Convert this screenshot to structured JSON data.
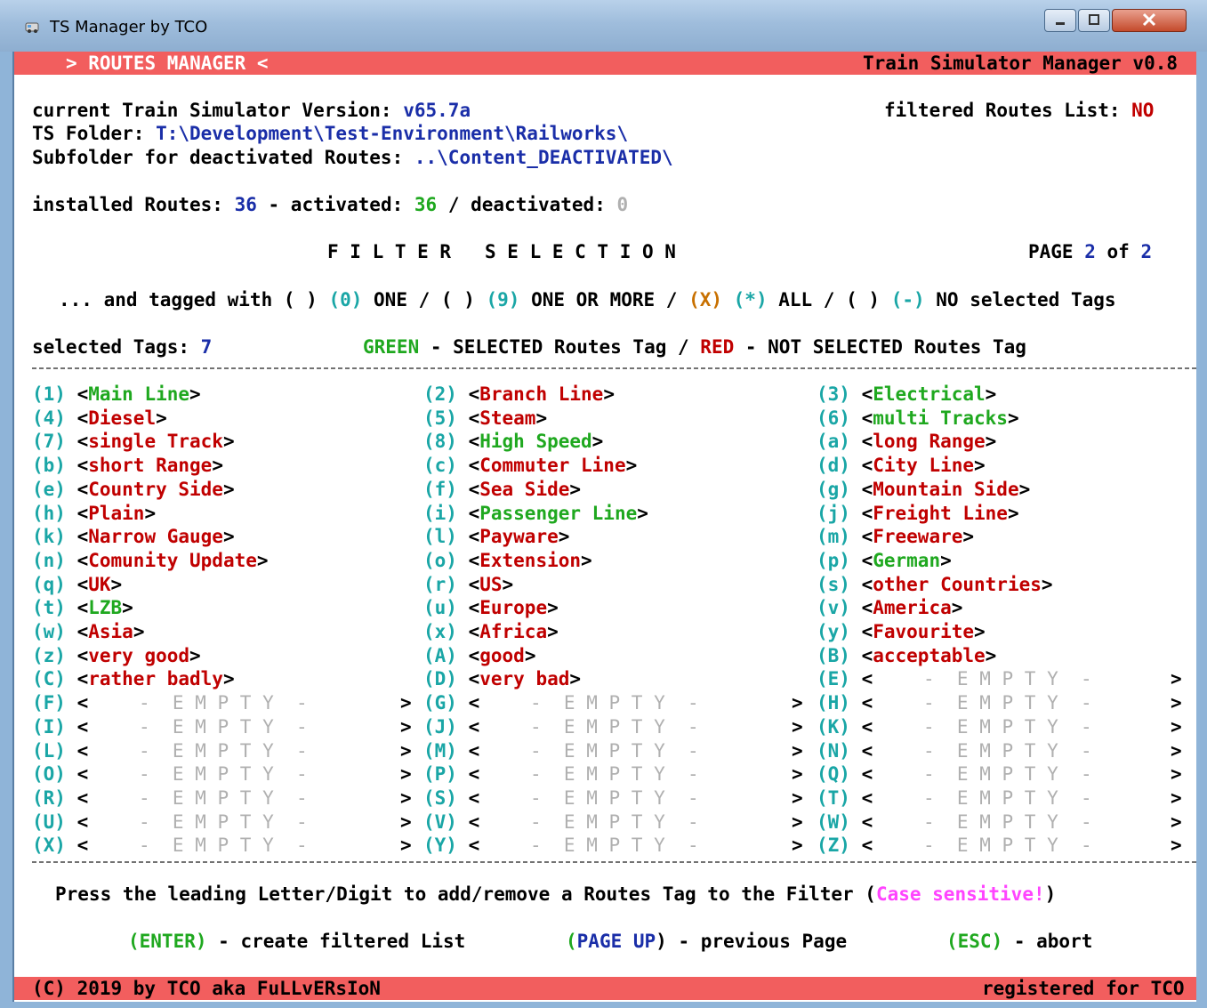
{
  "window": {
    "title": "TS Manager by TCO"
  },
  "header": {
    "left": "> ROUTES MANAGER <",
    "right": "Train Simulator Manager v0.8"
  },
  "info": {
    "version_label": "current Train Simulator Version: ",
    "version_value": "v65.7a",
    "filtered_label": "filtered Routes List: ",
    "filtered_value": "NO",
    "folder_label": "TS Folder: ",
    "folder_value": "T:\\Development\\Test-Environment\\Railworks\\",
    "subfolder_label": "Subfolder for deactivated Routes: ",
    "subfolder_value": "..\\Content_DEACTIVATED\\",
    "installed_label": "installed Routes: ",
    "installed_value": "36",
    "activated_label": " - activated: ",
    "activated_value": "36",
    "deactivated_label": " / deactivated: ",
    "deactivated_value": "0"
  },
  "filter": {
    "heading": "F I L T E R   S E L E C T I O N",
    "page_label": "PAGE ",
    "page_current": "2",
    "page_of": " of ",
    "page_total": "2",
    "tagged_prefix": "... and tagged with ",
    "opt1_box": "( ) ",
    "opt1_key": "(0)",
    "opt1_text": " ONE / ",
    "opt2_box": "( ) ",
    "opt2_key": "(9)",
    "opt2_text": " ONE OR MORE / ",
    "opt3_box": "(X) ",
    "opt3_key": "(*)",
    "opt3_text": " ALL / ",
    "opt4_box": "( ) ",
    "opt4_key": "(-)",
    "opt4_text": " NO selected Tags",
    "selected_label": "selected Tags: ",
    "selected_value": "7",
    "legend_green": "GREEN",
    "legend_mid": " - SELECTED Routes Tag / ",
    "legend_red": "RED",
    "legend_end": " - NOT SELECTED Routes Tag"
  },
  "tags": [
    {
      "key": "(1)",
      "name": "Main Line",
      "color": "#1fa81f"
    },
    {
      "key": "(2)",
      "name": "Branch Line",
      "color": "#c00000"
    },
    {
      "key": "(3)",
      "name": "Electrical",
      "color": "#1fa81f"
    },
    {
      "key": "(4)",
      "name": "Diesel",
      "color": "#c00000"
    },
    {
      "key": "(5)",
      "name": "Steam",
      "color": "#c00000"
    },
    {
      "key": "(6)",
      "name": "multi Tracks",
      "color": "#1fa81f"
    },
    {
      "key": "(7)",
      "name": "single Track",
      "color": "#c00000"
    },
    {
      "key": "(8)",
      "name": "High Speed",
      "color": "#1fa81f"
    },
    {
      "key": "(a)",
      "name": "long Range",
      "color": "#c00000"
    },
    {
      "key": "(b)",
      "name": "short Range",
      "color": "#c00000"
    },
    {
      "key": "(c)",
      "name": "Commuter Line",
      "color": "#c00000"
    },
    {
      "key": "(d)",
      "name": "City Line",
      "color": "#c00000"
    },
    {
      "key": "(e)",
      "name": "Country Side",
      "color": "#c00000"
    },
    {
      "key": "(f)",
      "name": "Sea Side",
      "color": "#c00000"
    },
    {
      "key": "(g)",
      "name": "Mountain Side",
      "color": "#c00000"
    },
    {
      "key": "(h)",
      "name": "Plain",
      "color": "#c00000"
    },
    {
      "key": "(i)",
      "name": "Passenger Line",
      "color": "#1fa81f"
    },
    {
      "key": "(j)",
      "name": "Freight Line",
      "color": "#c00000"
    },
    {
      "key": "(k)",
      "name": "Narrow Gauge",
      "color": "#c00000"
    },
    {
      "key": "(l)",
      "name": "Payware",
      "color": "#c00000"
    },
    {
      "key": "(m)",
      "name": "Freeware",
      "color": "#c00000"
    },
    {
      "key": "(n)",
      "name": "Comunity Update",
      "color": "#c00000"
    },
    {
      "key": "(o)",
      "name": "Extension",
      "color": "#c00000"
    },
    {
      "key": "(p)",
      "name": "German",
      "color": "#1fa81f"
    },
    {
      "key": "(q)",
      "name": "UK",
      "color": "#c00000"
    },
    {
      "key": "(r)",
      "name": "US",
      "color": "#c00000"
    },
    {
      "key": "(s)",
      "name": "other Countries",
      "color": "#c00000"
    },
    {
      "key": "(t)",
      "name": "LZB",
      "color": "#1fa81f"
    },
    {
      "key": "(u)",
      "name": "Europe",
      "color": "#c00000"
    },
    {
      "key": "(v)",
      "name": "America",
      "color": "#c00000"
    },
    {
      "key": "(w)",
      "name": "Asia",
      "color": "#c00000"
    },
    {
      "key": "(x)",
      "name": "Africa",
      "color": "#c00000"
    },
    {
      "key": "(y)",
      "name": "Favourite",
      "color": "#c00000"
    },
    {
      "key": "(z)",
      "name": "very good",
      "color": "#c00000"
    },
    {
      "key": "(A)",
      "name": "good",
      "color": "#c00000"
    },
    {
      "key": "(B)",
      "name": "acceptable",
      "color": "#c00000"
    },
    {
      "key": "(C)",
      "name": "rather badly",
      "color": "#c00000"
    },
    {
      "key": "(D)",
      "name": "very bad",
      "color": "#c00000"
    },
    {
      "key": "(E)",
      "name": "",
      "color": ""
    },
    {
      "key": "(F)",
      "name": "",
      "color": ""
    },
    {
      "key": "(G)",
      "name": "",
      "color": ""
    },
    {
      "key": "(H)",
      "name": "",
      "color": ""
    },
    {
      "key": "(I)",
      "name": "",
      "color": ""
    },
    {
      "key": "(J)",
      "name": "",
      "color": ""
    },
    {
      "key": "(K)",
      "name": "",
      "color": ""
    },
    {
      "key": "(L)",
      "name": "",
      "color": ""
    },
    {
      "key": "(M)",
      "name": "",
      "color": ""
    },
    {
      "key": "(N)",
      "name": "",
      "color": ""
    },
    {
      "key": "(O)",
      "name": "",
      "color": ""
    },
    {
      "key": "(P)",
      "name": "",
      "color": ""
    },
    {
      "key": "(Q)",
      "name": "",
      "color": ""
    },
    {
      "key": "(R)",
      "name": "",
      "color": ""
    },
    {
      "key": "(S)",
      "name": "",
      "color": ""
    },
    {
      "key": "(T)",
      "name": "",
      "color": ""
    },
    {
      "key": "(U)",
      "name": "",
      "color": ""
    },
    {
      "key": "(V)",
      "name": "",
      "color": ""
    },
    {
      "key": "(W)",
      "name": "",
      "color": ""
    },
    {
      "key": "(X)",
      "name": "",
      "color": ""
    },
    {
      "key": "(Y)",
      "name": "",
      "color": ""
    },
    {
      "key": "(Z)",
      "name": "",
      "color": ""
    }
  ],
  "empty_slot_text": "-  E M P T Y  -",
  "footer": {
    "press_text": "Press the leading Letter/Digit to add/remove a Routes Tag to the Filter (",
    "case_text": "Case sensitive!",
    "press_close": ")",
    "enter_key": "(ENTER)",
    "enter_text": " - create filtered List",
    "pageup_open": "(",
    "pageup_key": "PAGE UP",
    "pageup_text": ") - previous Page",
    "esc_key": "(ESC)",
    "esc_text": " - abort",
    "copyright": "(C) 2019 by TCO aka FuLLvERsIoN",
    "registered": "registered for TCO"
  },
  "colors": {
    "header_bar": "#f25e5e",
    "selected_tag": "#1fa81f",
    "not_selected_tag": "#c00000",
    "key_cyan": "#1aa6a6",
    "value_blue": "#1a2ea8",
    "empty_gray": "#b0b0b0",
    "case_magenta": "#ff44ff"
  }
}
